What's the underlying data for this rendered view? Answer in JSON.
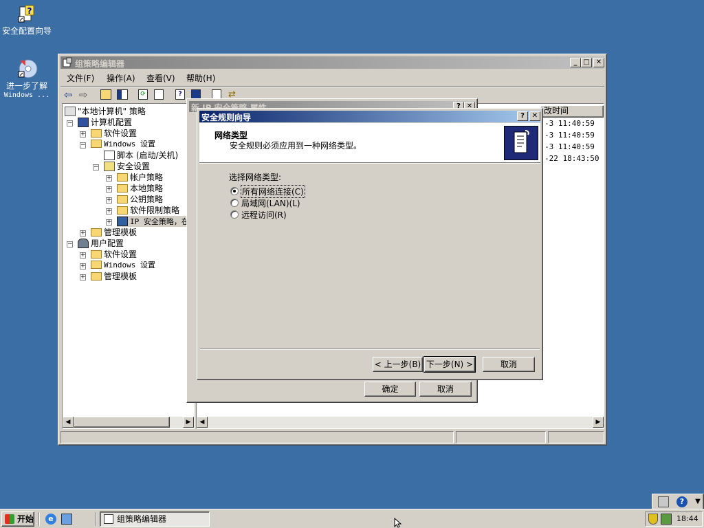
{
  "desktop": {
    "icons": [
      {
        "label": "安全配置向导"
      },
      {
        "label": "进一步了解",
        "label2": "Windows ..."
      }
    ]
  },
  "gpedit": {
    "title": "组策略编辑器",
    "menu": [
      "文件(F)",
      "操作(A)",
      "查看(V)",
      "帮助(H)"
    ],
    "tree": {
      "root": "\"本地计算机\" 策略",
      "computer_config": "计算机配置",
      "software_settings": "软件设置",
      "windows_settings": "Windows 设置",
      "scripts": "脚本 (启动/关机)",
      "security_settings": "安全设置",
      "account_policy": "帐户策略",
      "local_policy": "本地策略",
      "public_key": "公钥策略",
      "software_restriction": "软件限制策略",
      "ip_security": "IP 安全策略，在",
      "admin_templates": "管理模板",
      "user_config": "用户配置",
      "user_software": "软件设置",
      "user_windows": "Windows 设置",
      "user_admin": "管理模板"
    },
    "right_header": "改时间",
    "right_rows": [
      "-3 11:40:59",
      "-3 11:40:59",
      "-3 11:40:59",
      "-22 18:43:50"
    ]
  },
  "props_dialog": {
    "title": "新 IP 安全策略 属性",
    "ok": "确定",
    "cancel": "取消"
  },
  "wizard": {
    "title": "安全规则向导",
    "header_title": "网络类型",
    "header_subtitle": "安全规则必须应用到一种网络类型。",
    "prompt": "选择网络类型:",
    "options": [
      {
        "label": "所有网络连接(C)",
        "selected": true
      },
      {
        "label": "局域网(LAN)(L)",
        "selected": false
      },
      {
        "label": "远程访问(R)",
        "selected": false
      }
    ],
    "back": "< 上一步(B)",
    "next": "下一步(N) >",
    "cancel": "取消"
  },
  "taskbar": {
    "start": "开始",
    "task": "组策略编辑器",
    "clock": "18:44"
  }
}
